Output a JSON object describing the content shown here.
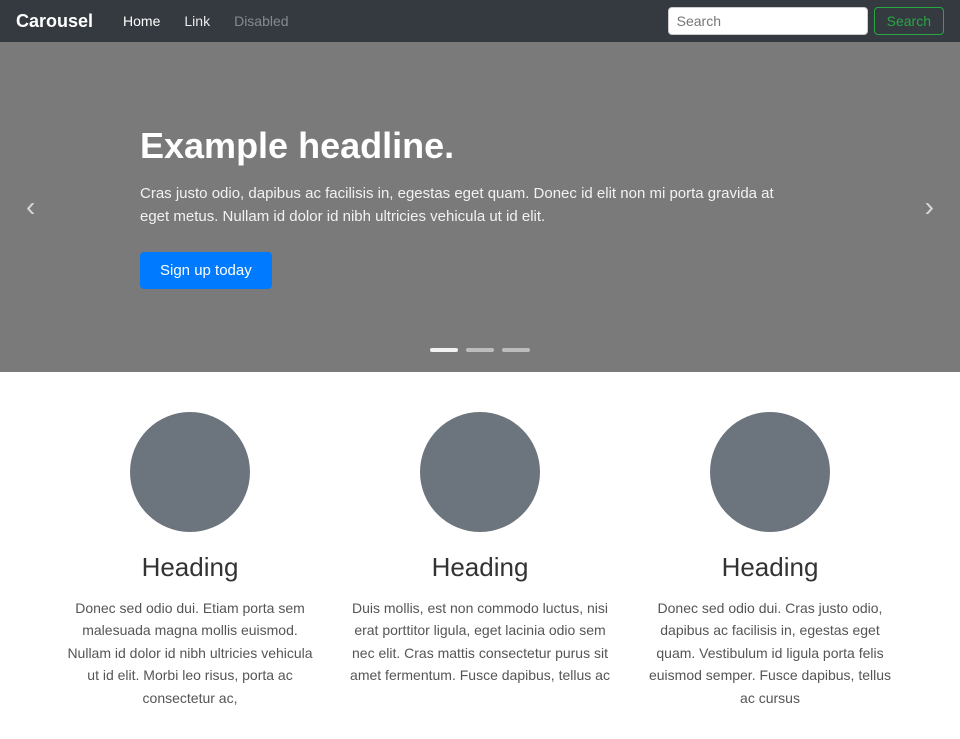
{
  "navbar": {
    "brand": "Carousel",
    "links": [
      {
        "label": "Home",
        "state": "active"
      },
      {
        "label": "Link",
        "state": "normal"
      },
      {
        "label": "Disabled",
        "state": "muted"
      }
    ],
    "search": {
      "placeholder": "Search",
      "button_label": "Search"
    }
  },
  "carousel": {
    "headline": "Example headline.",
    "text": "Cras justo odio, dapibus ac facilisis in, egestas eget quam. Donec id elit non mi porta gravida at eget metus. Nullam id dolor id nibh ultricies vehicula ut id elit.",
    "cta_label": "Sign up today",
    "prev_label": "‹",
    "next_label": "›",
    "dots": [
      {
        "active": true
      },
      {
        "active": false
      },
      {
        "active": false
      }
    ]
  },
  "cards": [
    {
      "heading": "Heading",
      "text": "Donec sed odio dui. Etiam porta sem malesuada magna mollis euismod. Nullam id dolor id nibh ultricies vehicula ut id elit. Morbi leo risus, porta ac consectetur ac,"
    },
    {
      "heading": "Heading",
      "text": "Duis mollis, est non commodo luctus, nisi erat porttitor ligula, eget lacinia odio sem nec elit. Cras mattis consectetur purus sit amet fermentum. Fusce dapibus, tellus ac"
    },
    {
      "heading": "Heading",
      "text": "Donec sed odio dui. Cras justo odio, dapibus ac facilisis in, egestas eget quam. Vestibulum id ligula porta felis euismod semper. Fusce dapibus, tellus ac cursus"
    }
  ]
}
